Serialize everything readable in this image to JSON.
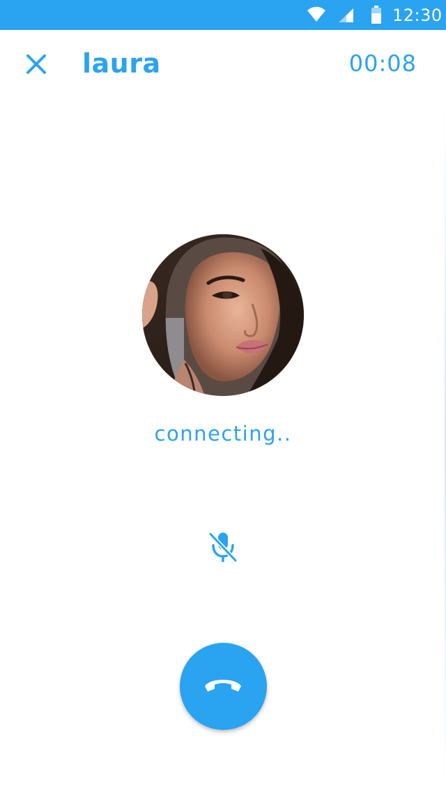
{
  "status_bar": {
    "time": "12:30",
    "icons": [
      "wifi-icon",
      "signal-icon",
      "battery-icon"
    ],
    "background": "#2aa3f0"
  },
  "header": {
    "close_icon": "close-icon",
    "contact_name": "laura",
    "timer": "00:08"
  },
  "call": {
    "avatar_alt": "laura",
    "status": "connecting..",
    "mute_icon": "mic-off-icon",
    "end_call_icon": "phone-hangup-icon"
  },
  "colors": {
    "accent": "#2aa3f0",
    "background": "#ffffff"
  }
}
